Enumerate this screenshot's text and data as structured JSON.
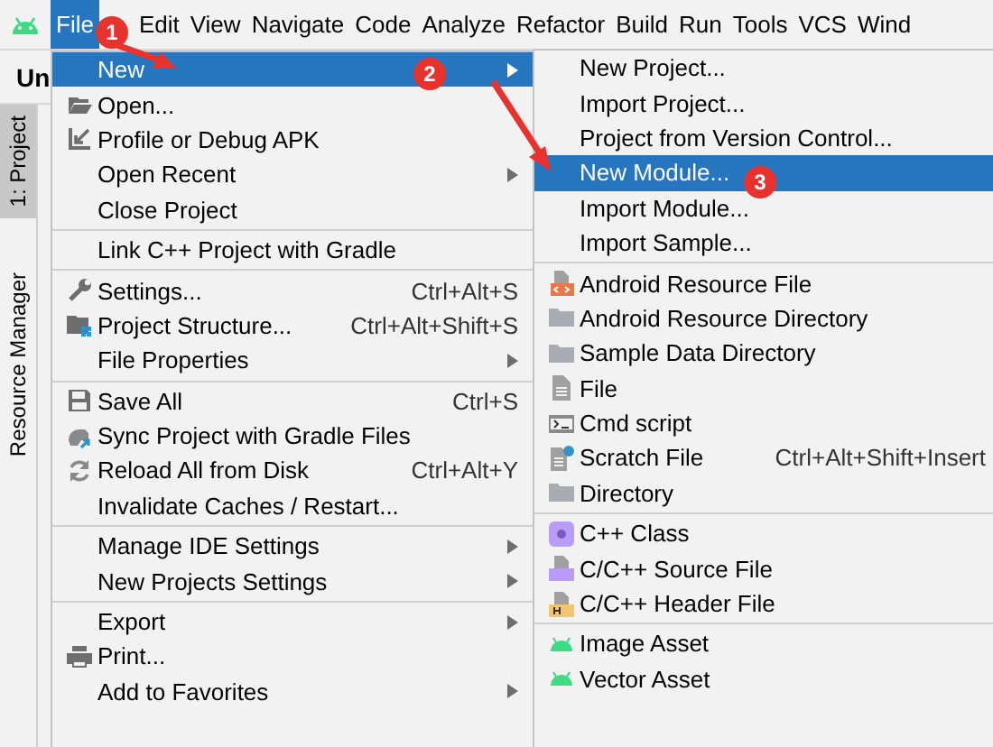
{
  "menubar": {
    "items": [
      {
        "label": "File",
        "selected": true
      },
      {
        "label": "Edit",
        "selected": false
      },
      {
        "label": "View",
        "selected": false
      },
      {
        "label": "Navigate",
        "selected": false
      },
      {
        "label": "Code",
        "selected": false
      },
      {
        "label": "Analyze",
        "selected": false
      },
      {
        "label": "Refactor",
        "selected": false
      },
      {
        "label": "Build",
        "selected": false
      },
      {
        "label": "Run",
        "selected": false
      },
      {
        "label": "Tools",
        "selected": false
      },
      {
        "label": "VCS",
        "selected": false
      },
      {
        "label": "Wind",
        "selected": false
      }
    ]
  },
  "toolbar": {
    "title": "Un"
  },
  "tool_windows": [
    {
      "label": "1: Project",
      "selected": true
    },
    {
      "label": "Resource Manager",
      "selected": false
    }
  ],
  "file_menu": {
    "items": [
      {
        "kind": "item",
        "label": "New",
        "selected": true,
        "submenu": true
      },
      {
        "kind": "item",
        "label": "Open...",
        "selected": false
      },
      {
        "kind": "item",
        "label": "Profile or Debug APK",
        "selected": false
      },
      {
        "kind": "item",
        "label": "Open Recent",
        "selected": false,
        "submenu": true
      },
      {
        "kind": "item",
        "label": "Close Project",
        "selected": false
      },
      {
        "kind": "separator"
      },
      {
        "kind": "item",
        "label": "Link C++ Project with Gradle",
        "selected": false
      },
      {
        "kind": "separator"
      },
      {
        "kind": "item",
        "label": "Settings...",
        "shortcut": "Ctrl+Alt+S",
        "selected": false
      },
      {
        "kind": "item",
        "label": "Project Structure...",
        "shortcut": "Ctrl+Alt+Shift+S",
        "selected": false
      },
      {
        "kind": "item",
        "label": "File Properties",
        "selected": false,
        "submenu": true
      },
      {
        "kind": "separator"
      },
      {
        "kind": "item",
        "label": "Save All",
        "shortcut": "Ctrl+S",
        "selected": false
      },
      {
        "kind": "item",
        "label": "Sync Project with Gradle Files",
        "selected": false
      },
      {
        "kind": "item",
        "label": "Reload All from Disk",
        "shortcut": "Ctrl+Alt+Y",
        "selected": false
      },
      {
        "kind": "item",
        "label": "Invalidate Caches / Restart...",
        "selected": false
      },
      {
        "kind": "separator"
      },
      {
        "kind": "item",
        "label": "Manage IDE Settings",
        "selected": false,
        "submenu": true
      },
      {
        "kind": "item",
        "label": "New Projects Settings",
        "selected": false,
        "submenu": true
      },
      {
        "kind": "separator"
      },
      {
        "kind": "item",
        "label": "Export",
        "selected": false,
        "submenu": true
      },
      {
        "kind": "item",
        "label": "Print...",
        "selected": false
      },
      {
        "kind": "item",
        "label": "Add to Favorites",
        "selected": false,
        "submenu": true
      }
    ]
  },
  "new_submenu": {
    "items": [
      {
        "kind": "item",
        "label": "New Project...",
        "selected": false
      },
      {
        "kind": "item",
        "label": "Import Project...",
        "selected": false
      },
      {
        "kind": "item",
        "label": "Project from Version Control...",
        "selected": false
      },
      {
        "kind": "item",
        "label": "New Module...",
        "selected": true
      },
      {
        "kind": "item",
        "label": "Import Module...",
        "selected": false
      },
      {
        "kind": "item",
        "label": "Import Sample...",
        "selected": false
      },
      {
        "kind": "separator"
      },
      {
        "kind": "item",
        "label": "Android Resource File",
        "selected": false
      },
      {
        "kind": "item",
        "label": "Android Resource Directory",
        "selected": false
      },
      {
        "kind": "item",
        "label": "Sample Data Directory",
        "selected": false
      },
      {
        "kind": "item",
        "label": "File",
        "selected": false
      },
      {
        "kind": "item",
        "label": "Cmd script",
        "selected": false
      },
      {
        "kind": "item",
        "label": "Scratch File",
        "shortcut": "Ctrl+Alt+Shift+Insert",
        "selected": false
      },
      {
        "kind": "item",
        "label": "Directory",
        "selected": false
      },
      {
        "kind": "separator"
      },
      {
        "kind": "item",
        "label": "C++ Class",
        "selected": false
      },
      {
        "kind": "item",
        "label": "C/C++ Source File",
        "selected": false
      },
      {
        "kind": "item",
        "label": "C/C++ Header File",
        "selected": false
      },
      {
        "kind": "separator"
      },
      {
        "kind": "item",
        "label": "Image Asset",
        "selected": false
      },
      {
        "kind": "item",
        "label": "Vector Asset",
        "selected": false
      }
    ]
  },
  "annotations": [
    {
      "label": "1"
    },
    {
      "label": "2"
    },
    {
      "label": "3"
    }
  ]
}
